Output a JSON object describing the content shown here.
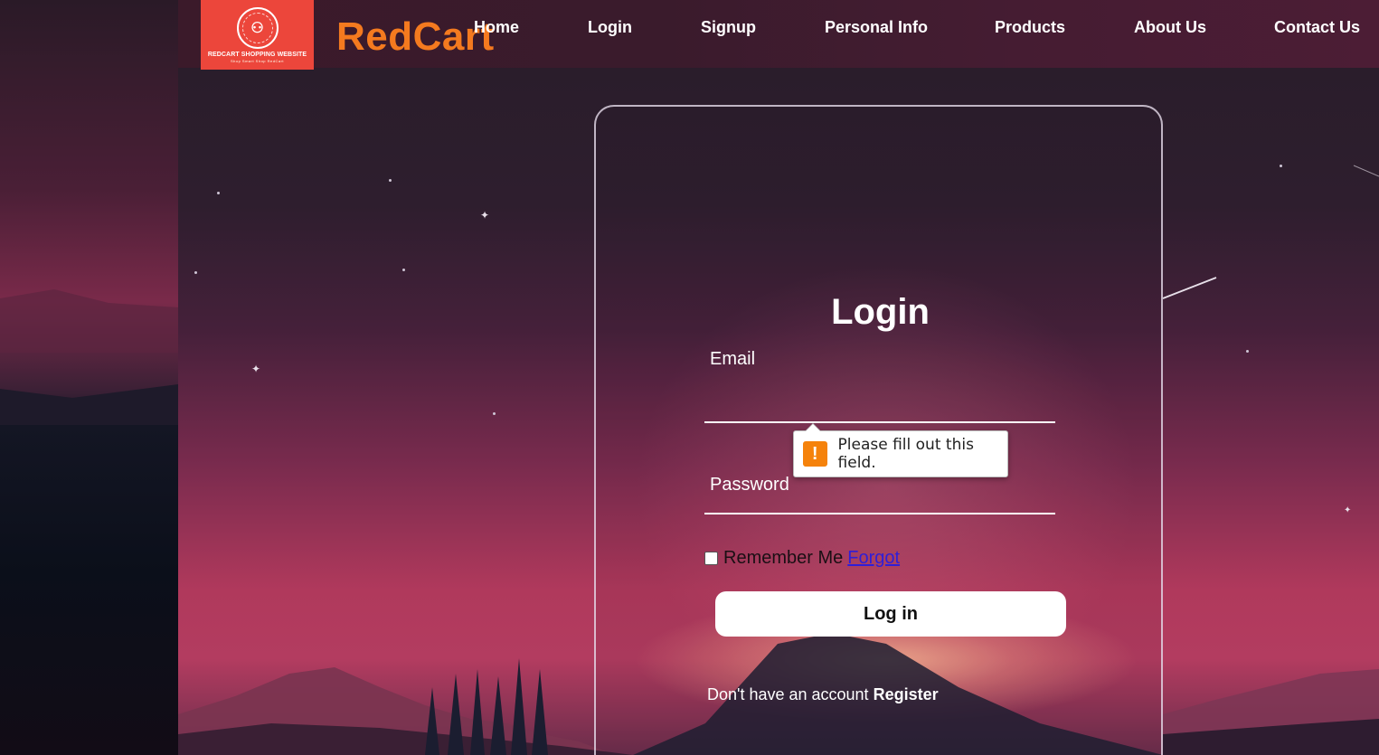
{
  "header": {
    "logo": {
      "text": "REDCART SHOPPING WEBSITE",
      "tagline": "Shop Smart Shop RedCart",
      "icon": "family-icon"
    },
    "brand": "RedCart",
    "nav": [
      "Home",
      "Login",
      "Signup",
      "Personal Info",
      "Products",
      "About Us",
      "Contact Us"
    ]
  },
  "login": {
    "title": "Login",
    "email_label": "Email",
    "email_value": "",
    "password_label": "Password",
    "password_value": "",
    "remember_label": "Remember Me",
    "remember_checked": false,
    "forgot_label": "Forgot",
    "submit_label": "Log in",
    "register_prompt": "Don't have an account",
    "register_label": "Register"
  },
  "validation": {
    "message": "Please fill out this field.",
    "icon": "warning-icon",
    "color": "#f5820b"
  },
  "colors": {
    "brand": "#f47a1f",
    "logo_bg": "#ec463b",
    "link": "#2f1ed8"
  }
}
